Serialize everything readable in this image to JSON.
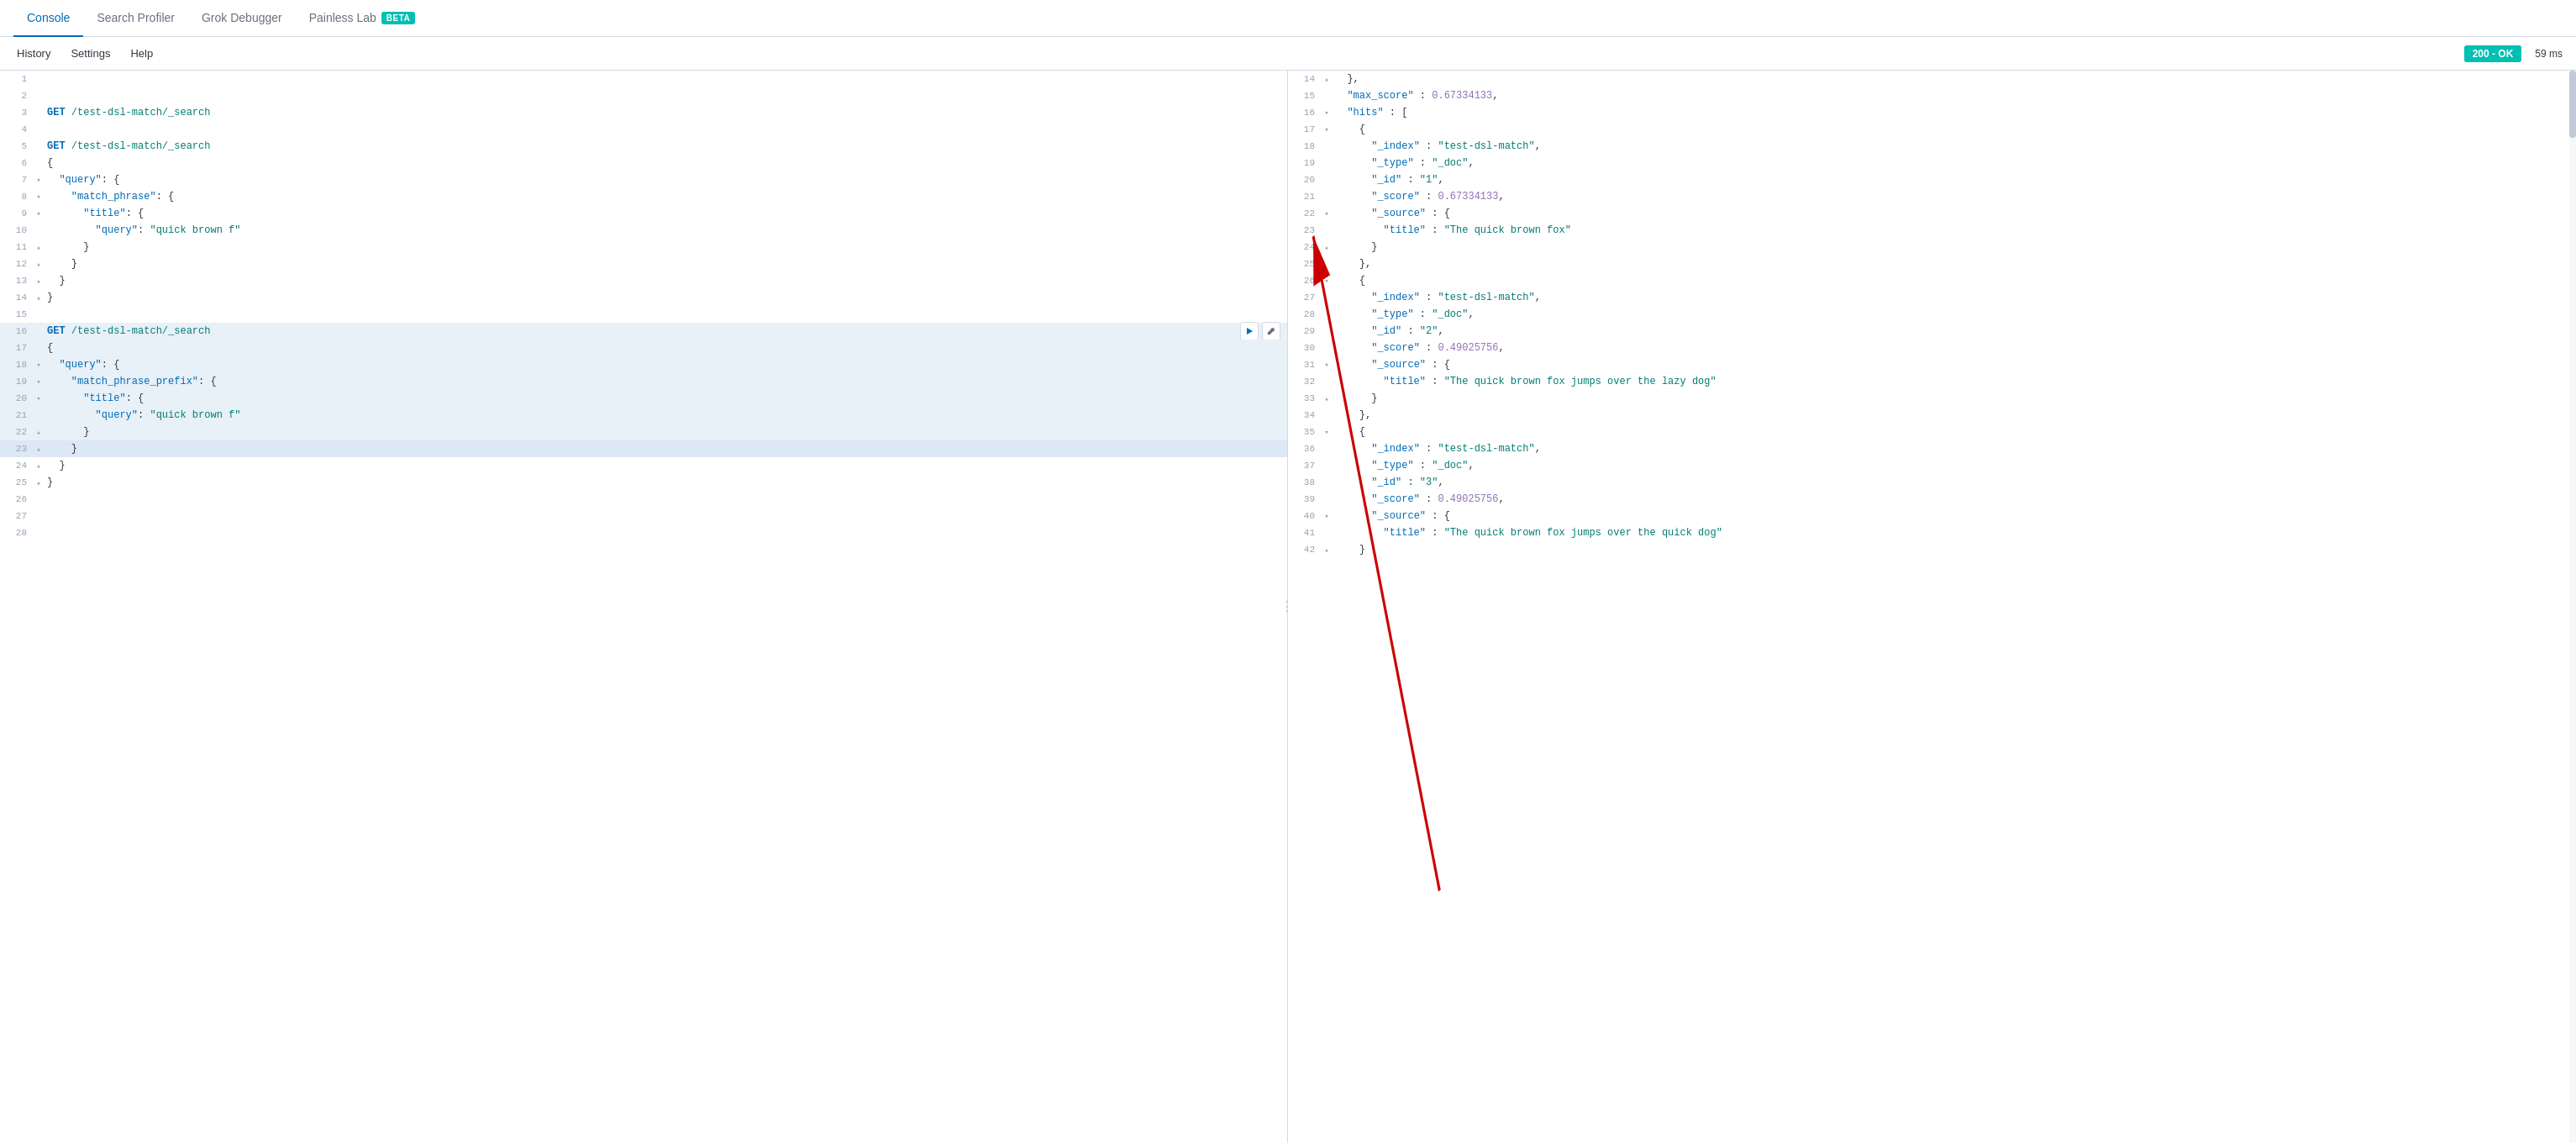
{
  "tabs": [
    {
      "id": "console",
      "label": "Console",
      "active": true
    },
    {
      "id": "search-profiler",
      "label": "Search Profiler",
      "active": false
    },
    {
      "id": "grok-debugger",
      "label": "Grok Debugger",
      "active": false
    },
    {
      "id": "painless-lab",
      "label": "Painless Lab",
      "active": false,
      "beta": true
    }
  ],
  "toolbar": {
    "history_label": "History",
    "settings_label": "Settings",
    "help_label": "Help",
    "status": "200 - OK",
    "timing": "59 ms"
  },
  "editor": {
    "lines": [
      {
        "num": 1,
        "fold": "",
        "content": "",
        "type": "blank"
      },
      {
        "num": 2,
        "fold": "",
        "content": "",
        "type": "blank"
      },
      {
        "num": 3,
        "fold": "",
        "content": "GET /test-dsl-match/_search",
        "type": "get"
      },
      {
        "num": 4,
        "fold": "",
        "content": "",
        "type": "blank"
      },
      {
        "num": 5,
        "fold": "",
        "content": "GET /test-dsl-match/_search",
        "type": "get"
      },
      {
        "num": 6,
        "fold": "",
        "content": "{",
        "type": "code"
      },
      {
        "num": 7,
        "fold": "▾",
        "content": "  \"query\": {",
        "type": "code"
      },
      {
        "num": 8,
        "fold": "▾",
        "content": "    \"match_phrase\": {",
        "type": "code"
      },
      {
        "num": 9,
        "fold": "▾",
        "content": "      \"title\": {",
        "type": "code"
      },
      {
        "num": 10,
        "fold": "",
        "content": "        \"query\": \"quick brown f\"",
        "type": "code"
      },
      {
        "num": 11,
        "fold": "▴",
        "content": "      }",
        "type": "code"
      },
      {
        "num": 12,
        "fold": "▴",
        "content": "    }",
        "type": "code"
      },
      {
        "num": 13,
        "fold": "▴",
        "content": "  }",
        "type": "code"
      },
      {
        "num": 14,
        "fold": "▴",
        "content": "}",
        "type": "code"
      },
      {
        "num": 15,
        "fold": "",
        "content": "",
        "type": "blank"
      },
      {
        "num": 16,
        "fold": "",
        "content": "GET /test-dsl-match/_search",
        "type": "get",
        "highlight": true,
        "actions": true
      },
      {
        "num": 17,
        "fold": "",
        "content": "{",
        "type": "code",
        "highlight": true
      },
      {
        "num": 18,
        "fold": "▾",
        "content": "  \"query\": {",
        "type": "code",
        "highlight": true
      },
      {
        "num": 19,
        "fold": "▾",
        "content": "    \"match_phrase_prefix\": {",
        "type": "code",
        "highlight": true
      },
      {
        "num": 20,
        "fold": "▾",
        "content": "      \"title\": {",
        "type": "code",
        "highlight": true
      },
      {
        "num": 21,
        "fold": "",
        "content": "        \"query\": \"quick brown f\"",
        "type": "code",
        "highlight": true
      },
      {
        "num": 22,
        "fold": "▴",
        "content": "      }",
        "type": "code",
        "highlight": true
      },
      {
        "num": 23,
        "fold": "▴",
        "content": "    }",
        "type": "code",
        "highlight": true,
        "current": true
      },
      {
        "num": 24,
        "fold": "▴",
        "content": "  }",
        "type": "code"
      },
      {
        "num": 25,
        "fold": "▴",
        "content": "}",
        "type": "code"
      },
      {
        "num": 26,
        "fold": "",
        "content": "",
        "type": "blank"
      },
      {
        "num": 27,
        "fold": "",
        "content": "",
        "type": "blank"
      },
      {
        "num": 28,
        "fold": "",
        "content": "",
        "type": "blank"
      }
    ]
  },
  "output": {
    "lines": [
      {
        "num": 14,
        "fold": "▴",
        "content": "  },"
      },
      {
        "num": 15,
        "fold": "",
        "content": "  \"max_score\" : 0.67334133,"
      },
      {
        "num": 16,
        "fold": "▾",
        "content": "  \"hits\" : ["
      },
      {
        "num": 17,
        "fold": "▾",
        "content": "    {"
      },
      {
        "num": 18,
        "fold": "",
        "content": "      \"_index\" : \"test-dsl-match\","
      },
      {
        "num": 19,
        "fold": "",
        "content": "      \"_type\" : \"_doc\","
      },
      {
        "num": 20,
        "fold": "",
        "content": "      \"_id\" : \"1\","
      },
      {
        "num": 21,
        "fold": "",
        "content": "      \"_score\" : 0.67334133,"
      },
      {
        "num": 22,
        "fold": "▾",
        "content": "      \"_source\" : {"
      },
      {
        "num": 23,
        "fold": "",
        "content": "        \"title\" : \"The quick brown fox\""
      },
      {
        "num": 24,
        "fold": "▴",
        "content": "      }"
      },
      {
        "num": 25,
        "fold": "",
        "content": "    },"
      },
      {
        "num": 26,
        "fold": "▾",
        "content": "    {"
      },
      {
        "num": 27,
        "fold": "",
        "content": "      \"_index\" : \"test-dsl-match\","
      },
      {
        "num": 28,
        "fold": "",
        "content": "      \"_type\" : \"_doc\","
      },
      {
        "num": 29,
        "fold": "",
        "content": "      \"_id\" : \"2\","
      },
      {
        "num": 30,
        "fold": "",
        "content": "      \"_score\" : 0.49025756,"
      },
      {
        "num": 31,
        "fold": "▾",
        "content": "      \"_source\" : {"
      },
      {
        "num": 32,
        "fold": "",
        "content": "        \"title\" : \"The quick brown fox jumps over the lazy dog\""
      },
      {
        "num": 33,
        "fold": "▴",
        "content": "      }"
      },
      {
        "num": 34,
        "fold": "",
        "content": "    },"
      },
      {
        "num": 35,
        "fold": "▾",
        "content": "    {"
      },
      {
        "num": 36,
        "fold": "",
        "content": "      \"_index\" : \"test-dsl-match\","
      },
      {
        "num": 37,
        "fold": "",
        "content": "      \"_type\" : \"_doc\","
      },
      {
        "num": 38,
        "fold": "",
        "content": "      \"_id\" : \"3\","
      },
      {
        "num": 39,
        "fold": "",
        "content": "      \"_score\" : 0.49025756,"
      },
      {
        "num": 40,
        "fold": "▾",
        "content": "      \"_source\" : {"
      },
      {
        "num": 41,
        "fold": "",
        "content": "        \"title\" : \"The quick brown fox jumps over the quick dog\""
      },
      {
        "num": 42,
        "fold": "▴",
        "content": "    }"
      }
    ]
  },
  "colors": {
    "active_tab": "#006bb4",
    "get_color": "#006bb4",
    "path_color": "#017d73",
    "key_color": "#006bb4",
    "string_color": "#017d73",
    "number_color": "#9170b8",
    "status_bg": "#00bfb3",
    "highlight_bg": "#e8f0f8",
    "current_line_bg": "#dce8f5"
  }
}
